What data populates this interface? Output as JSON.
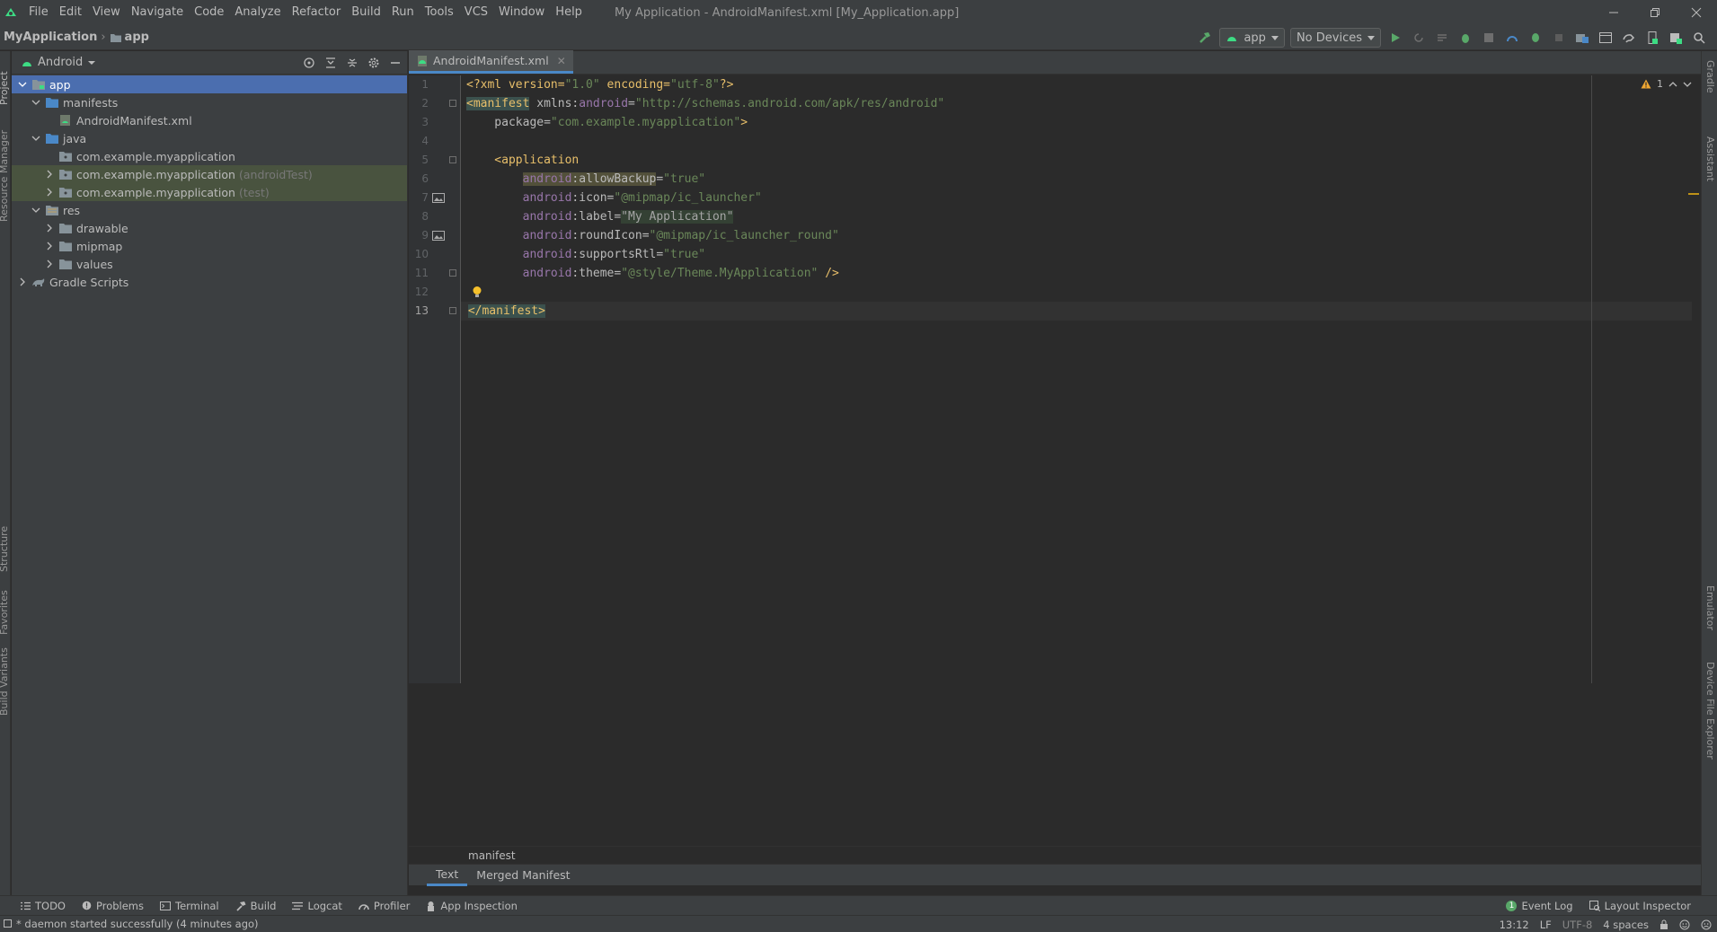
{
  "menubar": {
    "items": [
      "File",
      "Edit",
      "View",
      "Navigate",
      "Code",
      "Analyze",
      "Refactor",
      "Build",
      "Run",
      "Tools",
      "VCS",
      "Window",
      "Help"
    ],
    "window_title": "My Application - AndroidManifest.xml [My_Application.app]"
  },
  "navbar": {
    "project": "MyApplication",
    "module": "app",
    "run_config": "app",
    "device": "No Devices"
  },
  "left_stripe": [
    "Project",
    "Resource Manager",
    "Structure",
    "Favorites",
    "Build Variants"
  ],
  "right_stripe": [
    "Gradle",
    "Assistant",
    "Emulator",
    "Device File Explorer"
  ],
  "project_panel": {
    "view": "Android",
    "tree": [
      {
        "label": "app",
        "hint": "",
        "expanded": true,
        "icon": "module-folder-icon"
      },
      {
        "label": "manifests",
        "hint": "",
        "expanded": true,
        "icon": "folder-icon"
      },
      {
        "label": "AndroidManifest.xml",
        "hint": "",
        "expanded": null,
        "icon": "manifest-file-icon"
      },
      {
        "label": "java",
        "hint": "",
        "expanded": true,
        "icon": "folder-icon"
      },
      {
        "label": "com.example.myapplication",
        "hint": "",
        "expanded": null,
        "icon": "package-icon"
      },
      {
        "label": "com.example.myapplication",
        "hint": "(androidTest)",
        "expanded": false,
        "icon": "package-icon"
      },
      {
        "label": "com.example.myapplication",
        "hint": "(test)",
        "expanded": false,
        "icon": "package-icon"
      },
      {
        "label": "res",
        "hint": "",
        "expanded": true,
        "icon": "res-folder-icon"
      },
      {
        "label": "drawable",
        "hint": "",
        "expanded": false,
        "icon": "folder-icon"
      },
      {
        "label": "mipmap",
        "hint": "",
        "expanded": false,
        "icon": "folder-icon"
      },
      {
        "label": "values",
        "hint": "",
        "expanded": false,
        "icon": "folder-icon"
      },
      {
        "label": "Gradle Scripts",
        "hint": "",
        "expanded": false,
        "icon": "gradle-icon"
      }
    ]
  },
  "editor": {
    "tab": "AndroidManifest.xml",
    "warning_count": "1",
    "line_numbers": [
      "1",
      "2",
      "3",
      "4",
      "5",
      "6",
      "7",
      "8",
      "9",
      "10",
      "11",
      "12",
      "13"
    ],
    "code": {
      "l1_decl": "<?xml version=",
      "l1_v1": "\"1.0\"",
      "l1_enc": " encoding=",
      "l1_v2": "\"utf-8\"",
      "l1_end": "?>",
      "l2_tag": "<manifest",
      "l2_attr": " xmlns:",
      "l2_ns": "android",
      "l2_eq": "=",
      "l2_val": "\"http://schemas.android.com/apk/res/android\"",
      "l3_attr": "    package=",
      "l3_val": "\"com.example.myapplication\"",
      "l3_end": ">",
      "l5_tag": "    <application",
      "l6_ns": "android",
      "l6_attr": ":allowBackup",
      "l6_eq": "=",
      "l6_val": "\"true\"",
      "l7_ns": "android",
      "l7_attr": ":icon=",
      "l7_val": "\"@mipmap/ic_launcher\"",
      "l8_ns": "android",
      "l8_attr": ":label=",
      "l8_val": "\"My Application\"",
      "l9_ns": "android",
      "l9_attr": ":roundIcon=",
      "l9_val": "\"@mipmap/ic_launcher_round\"",
      "l10_ns": "android",
      "l10_attr": ":supportsRtl=",
      "l10_val": "\"true\"",
      "l11_ns": "android",
      "l11_attr": ":theme=",
      "l11_val": "\"@style/Theme.MyApplication\"",
      "l11_end": " />",
      "l13_tag": "</manifest>"
    },
    "breadcrumb": "manifest",
    "bottom_tabs": [
      "Text",
      "Merged Manifest"
    ]
  },
  "bottom_tools": {
    "left": [
      "TODO",
      "Problems",
      "Terminal",
      "Build",
      "Logcat",
      "Profiler",
      "App Inspection"
    ],
    "right": [
      "Event Log",
      "Layout Inspector"
    ],
    "event_count": "1"
  },
  "statusbar": {
    "message": "* daemon started successfully (4 minutes ago)",
    "position": "13:12",
    "line_sep": "LF",
    "encoding": "UTF-8",
    "indent": "4 spaces"
  },
  "colors": {
    "accent": "#4a88c7",
    "selection": "#4b6eaf",
    "run_green": "#59a869",
    "android_green": "#3ddc84"
  }
}
